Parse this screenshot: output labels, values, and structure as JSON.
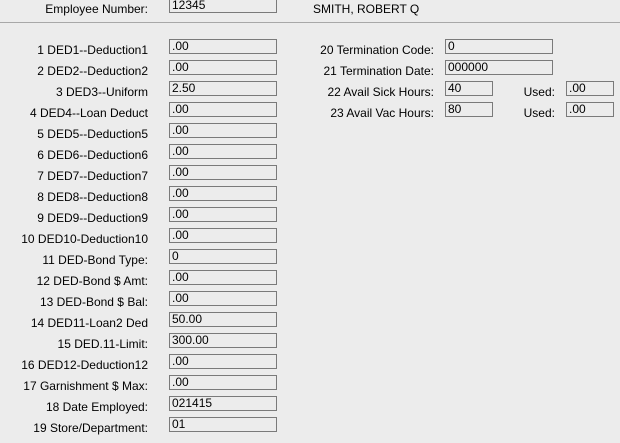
{
  "header": {
    "employee_number_label": "Employee Number:",
    "employee_number_value": "12345",
    "employee_name": "SMITH, ROBERT Q"
  },
  "left_fields": [
    {
      "label": "1 DED1--Deduction1",
      "value": ".00"
    },
    {
      "label": "2 DED2--Deduction2",
      "value": ".00"
    },
    {
      "label": "3 DED3--Uniform",
      "value": "2.50"
    },
    {
      "label": "4 DED4--Loan Deduct",
      "value": ".00"
    },
    {
      "label": "5 DED5--Deduction5",
      "value": ".00"
    },
    {
      "label": "6 DED6--Deduction6",
      "value": ".00"
    },
    {
      "label": "7 DED7--Deduction7",
      "value": ".00"
    },
    {
      "label": "8 DED8--Deduction8",
      "value": ".00"
    },
    {
      "label": "9 DED9--Deduction9",
      "value": ".00"
    },
    {
      "label": "10 DED10-Deduction10",
      "value": ".00"
    },
    {
      "label": "11 DED-Bond Type:",
      "value": "0"
    },
    {
      "label": "12 DED-Bond $ Amt:",
      "value": ".00"
    },
    {
      "label": "13 DED-Bond $ Bal:",
      "value": ".00"
    },
    {
      "label": "14 DED11-Loan2 Ded",
      "value": "50.00"
    },
    {
      "label": "15 DED.11-Limit:",
      "value": "300.00"
    },
    {
      "label": "16 DED12-Deduction12",
      "value": ".00"
    },
    {
      "label": "17 Garnishment $ Max:",
      "value": ".00"
    },
    {
      "label": "18 Date Employed:",
      "value": "021415"
    },
    {
      "label": "19 Store/Department:",
      "value": "01"
    }
  ],
  "right_fields": [
    {
      "label": "20 Termination Code:",
      "value": "0"
    },
    {
      "label": "21 Termination Date:",
      "value": "000000"
    },
    {
      "label": "22 Avail Sick Hours:",
      "value": "40",
      "used_label": "Used:",
      "used_value": ".00"
    },
    {
      "label": "23 Avail Vac Hours:",
      "value": "80",
      "used_label": "Used:",
      "used_value": ".00"
    }
  ]
}
